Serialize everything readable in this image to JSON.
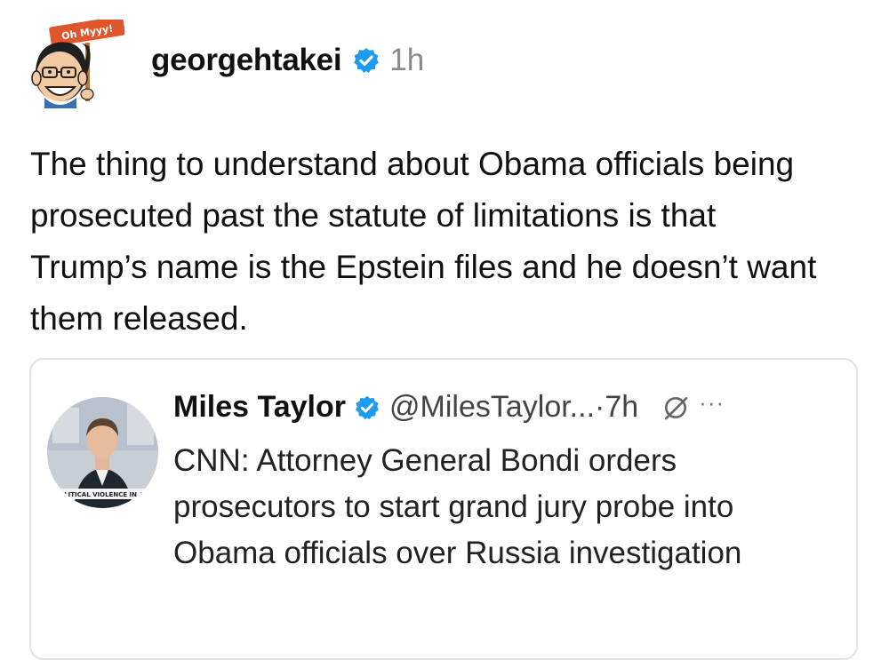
{
  "post": {
    "author_handle": "georgehtakei",
    "time_ago": "1h",
    "avatar_sign_text": "Oh Myyy!",
    "body": "The thing to understand about Obama officials being prosecuted past the statute of limitations is that Trump’s name is the Epstein files and he doesn’t want them released."
  },
  "quoted_post": {
    "author_name": "Miles Taylor",
    "handle_time": "@MilesTaylor...·7h",
    "more_label": "···",
    "avatar_banner_text": "POLITICAL VIOLENCE IN AM",
    "body": "CNN: Attorney General Bondi orders prosecutors to start grand jury probe into Obama officials over Russia investigation"
  },
  "colors": {
    "verified_badge": "#1d9bf0",
    "time_text": "#8a8a8a",
    "card_border": "#e2e2e2",
    "avatar_sign": "#e0562b"
  },
  "icons": {
    "verified": "verified-badge-icon",
    "grok": "grok-icon",
    "more": "more-options-icon"
  }
}
